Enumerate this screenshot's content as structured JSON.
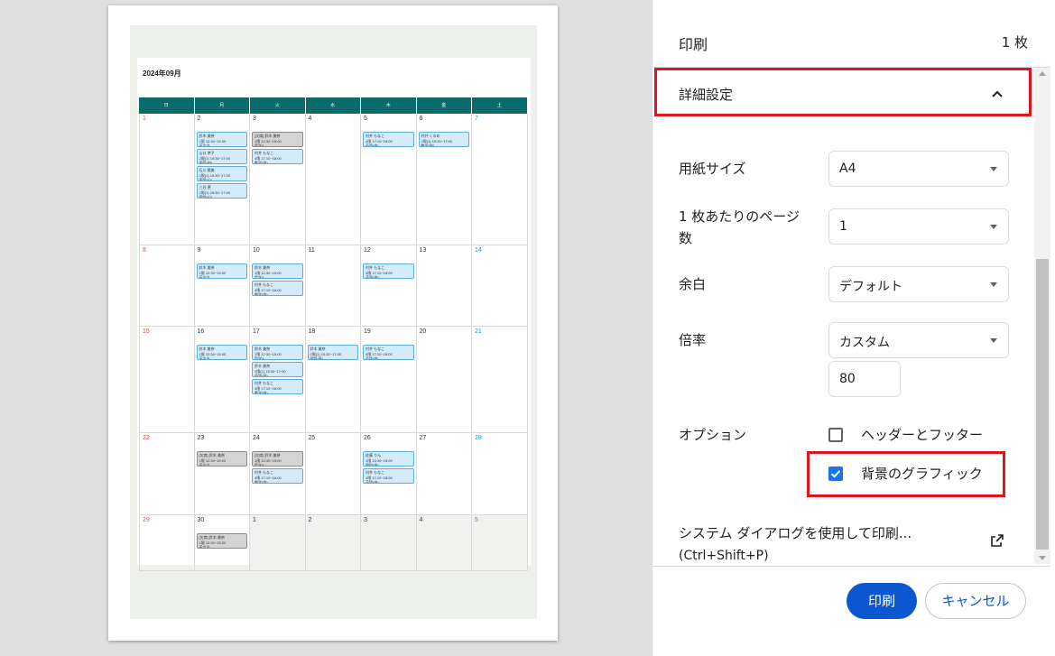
{
  "preview": {
    "calendar_title": "2024年09月",
    "weekdays": [
      "日",
      "月",
      "火",
      "水",
      "木",
      "金",
      "土"
    ],
    "weeks": [
      [
        {
          "day": "1",
          "kind": "sun",
          "events": []
        },
        {
          "day": "2",
          "events": [
            {
              "style": "blue",
              "lines": [
                "鈴木 美奈",
                "1限 12:30~15:00",
                "英文法"
              ]
            },
            {
              "style": "blue",
              "lines": [
                "山口 孝子",
                "2限(1) 15:30~17:00",
                "国語(中)"
              ]
            },
            {
              "style": "blue",
              "lines": [
                "石川 陽美",
                "2限(1) 15:30~17:00",
                "国語(小)"
              ]
            },
            {
              "style": "blue",
              "lines": [
                "三谷 遼",
                "2限(1) 15:30~17:00",
                "国語(小)"
              ]
            }
          ]
        },
        {
          "day": "3",
          "events": [
            {
              "style": "gray",
              "lines": [
                "[欠席] 鈴木 美奈",
                "1限 12:30~15:00",
                "哲学A"
              ]
            },
            {
              "style": "blue",
              "lines": [
                "村井 もなこ",
                "4限 17:10~18:00",
                "数学(中)"
              ]
            }
          ]
        },
        {
          "day": "4",
          "events": []
        },
        {
          "day": "5",
          "events": [
            {
              "style": "blue",
              "lines": [
                "村井 もなこ",
                "4限 17:10~18:00",
                "英語(中)"
              ]
            }
          ]
        },
        {
          "day": "6",
          "events": [
            {
              "style": "blue",
              "lines": [
                "村井 くるめ",
                "2限(1) 15:30~17:00",
                "数学(中)"
              ]
            }
          ]
        },
        {
          "day": "7",
          "kind": "sat",
          "events": []
        }
      ],
      [
        {
          "day": "8",
          "kind": "sun",
          "events": []
        },
        {
          "day": "9",
          "events": [
            {
              "style": "blue",
              "lines": [
                "鈴木 美奈",
                "1限 12:30~15:00",
                "英文法"
              ]
            }
          ]
        },
        {
          "day": "10",
          "events": [
            {
              "style": "blue",
              "lines": [
                "鈴木 美奈",
                "1限 12:30~15:00",
                "哲学A"
              ]
            },
            {
              "style": "blue",
              "lines": [
                "村井 もなこ",
                "4限 17:10~18:00",
                "数学(中)"
              ]
            }
          ]
        },
        {
          "day": "11",
          "events": []
        },
        {
          "day": "12",
          "events": [
            {
              "style": "blue",
              "lines": [
                "村井 もなこ",
                "4限 17:10~18:00",
                "英語(中)"
              ]
            }
          ]
        },
        {
          "day": "13",
          "events": []
        },
        {
          "day": "14",
          "kind": "sat",
          "events": []
        }
      ],
      [
        {
          "day": "15",
          "kind": "sun",
          "events": []
        },
        {
          "day": "16",
          "events": [
            {
              "style": "blue",
              "lines": [
                "鈴木 美奈",
                "1限 12:30~15:00",
                "英文法"
              ]
            }
          ]
        },
        {
          "day": "17",
          "events": [
            {
              "style": "blue",
              "lines": [
                "鈴木 美奈",
                "1限 12:30~15:00",
                "哲学A"
              ]
            },
            {
              "style": "blue",
              "lines": [
                "鈴木 美奈",
                "2限(1) 15:30~17:00",
                "英語(高)"
              ]
            },
            {
              "style": "blue",
              "lines": [
                "村井 もなこ",
                "4限 17:10~18:00",
                "数学(中)"
              ]
            }
          ]
        },
        {
          "day": "18",
          "events": [
            {
              "style": "blue",
              "lines": [
                "鈴木 美奈",
                "2限(1) 15:30~17:00",
                "国語(高)"
              ]
            }
          ]
        },
        {
          "day": "19",
          "events": [
            {
              "style": "blue",
              "lines": [
                "村井 もなこ",
                "4限 17:10~18:00",
                "英語(中)"
              ]
            }
          ]
        },
        {
          "day": "20",
          "events": []
        },
        {
          "day": "21",
          "kind": "sat",
          "events": []
        }
      ],
      [
        {
          "day": "22",
          "kind": "sun",
          "events": []
        },
        {
          "day": "23",
          "events": [
            {
              "style": "gray",
              "lines": [
                "[欠席] 鈴木 美奈",
                "1限 12:30~15:00",
                "英文法"
              ]
            }
          ]
        },
        {
          "day": "24",
          "events": [
            {
              "style": "gray",
              "lines": [
                "[欠席] 鈴木 美奈",
                "1限 12:30~15:00",
                "哲学A"
              ]
            },
            {
              "style": "blue",
              "lines": [
                "村井 もなこ",
                "4限 17:10~18:00",
                "数学(中)"
              ]
            }
          ]
        },
        {
          "day": "25",
          "events": []
        },
        {
          "day": "26",
          "events": [
            {
              "style": "blue",
              "lines": [
                "佐藤 りん",
                "1限 13:30~15:00",
                "理科(中)"
              ]
            },
            {
              "style": "blue",
              "lines": [
                "村井 もなこ",
                "4限 17:10~18:00",
                "英語(中)"
              ]
            }
          ]
        },
        {
          "day": "27",
          "events": []
        },
        {
          "day": "28",
          "kind": "sat",
          "events": []
        }
      ],
      [
        {
          "day": "29",
          "kind": "sun",
          "events": []
        },
        {
          "day": "30",
          "events": [
            {
              "style": "gray",
              "lines": [
                "[欠席] 鈴木 美奈",
                "1限 12:30~15:00",
                "英文法"
              ]
            }
          ]
        },
        {
          "day": "1",
          "outside": true,
          "events": []
        },
        {
          "day": "2",
          "outside": true,
          "events": []
        },
        {
          "day": "3",
          "outside": true,
          "events": []
        },
        {
          "day": "4",
          "outside": true,
          "events": []
        },
        {
          "day": "5",
          "kind": "sat",
          "outside": true,
          "events": []
        }
      ]
    ]
  },
  "panel": {
    "title": "印刷",
    "sheet_count": "1 枚",
    "advanced_settings": "詳細設定",
    "paper_size": {
      "label": "用紙サイズ",
      "value": "A4"
    },
    "pages_per_sheet": {
      "label_line1": "1 枚あたりのページ",
      "label_line2": "数",
      "value": "1"
    },
    "margins": {
      "label": "余白",
      "value": "デフォルト"
    },
    "scale": {
      "label": "倍率",
      "value": "カスタム",
      "custom_value": "80"
    },
    "options": {
      "label": "オプション",
      "header_footer": {
        "label": "ヘッダーとフッター",
        "checked": false
      },
      "background_graphics": {
        "label": "背景のグラフィック",
        "checked": true
      }
    },
    "system_dialog": {
      "line1": "システム ダイアログを使用して印刷...",
      "line2": "(Ctrl+Shift+P)"
    },
    "print_button": "印刷",
    "cancel_button": "キャンセル"
  },
  "colors": {
    "accent": "#0b57d0",
    "highlight_box": "#e0141e",
    "calendar_header": "#0b6b6a",
    "event_blue": "#d3ebfb",
    "event_gray": "#d4d4d4"
  }
}
